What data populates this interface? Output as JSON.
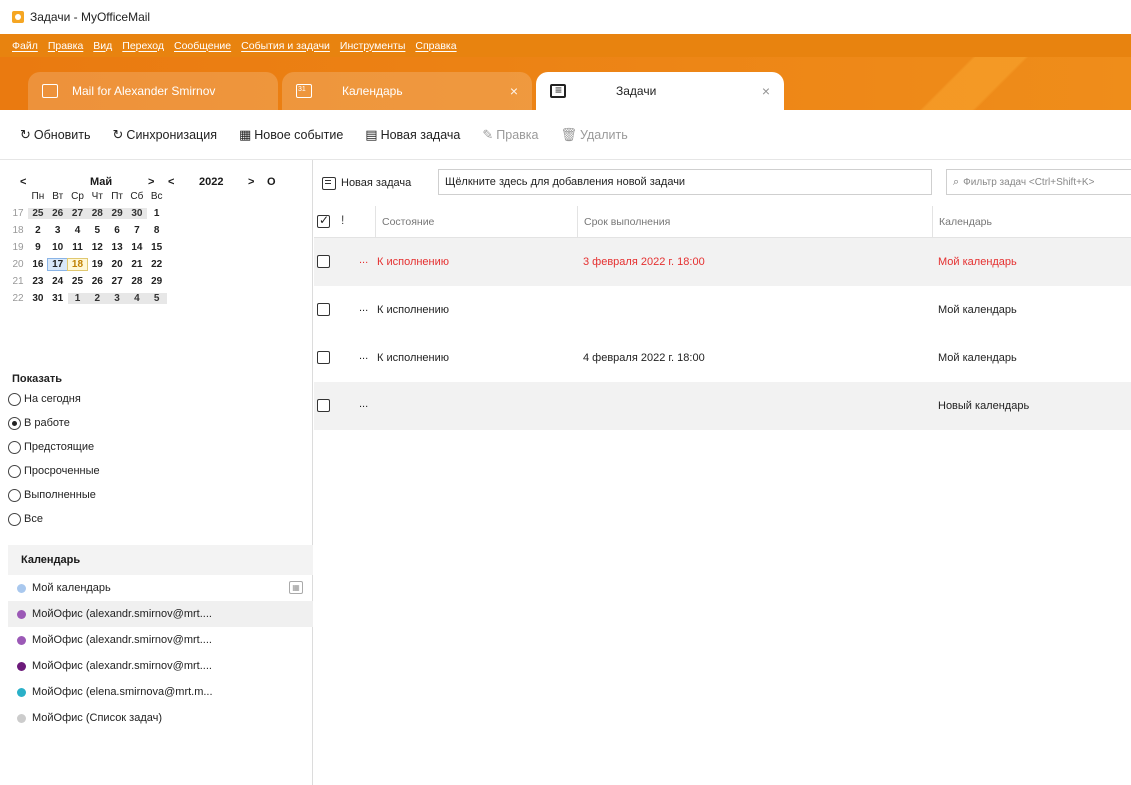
{
  "window": {
    "title": "Задачи - MyOfficeMail"
  },
  "menu": [
    "Файл",
    "Правка",
    "Вид",
    "Переход",
    "Сообщение",
    "События и задачи",
    "Инструменты",
    "Справка"
  ],
  "tabs": [
    {
      "label": "Mail for Alexander Smirnov",
      "icon": "folder-icon",
      "active": false
    },
    {
      "label": "Календарь",
      "icon": "calendar-icon",
      "active": false,
      "close": "×"
    },
    {
      "label": "Задачи",
      "icon": "tasks-icon",
      "active": true,
      "close": "×"
    }
  ],
  "toolbar": {
    "refresh": "Обновить",
    "sync": "Синхронизация",
    "new_event": "Новое событие",
    "new_task": "Новая задача",
    "edit": "Правка",
    "delete": "Удалить"
  },
  "mini_calendar": {
    "prev": "<",
    "month": "Май",
    "next": ">",
    "prev_year": "<",
    "year": "2022",
    "next_year": ">",
    "today_btn": "O",
    "weekdays": [
      "Пн",
      "Вт",
      "Ср",
      "Чт",
      "Пт",
      "Сб",
      "Вс"
    ],
    "weeks": [
      {
        "num": "17",
        "days": [
          "25",
          "26",
          "27",
          "28",
          "29",
          "30",
          "1"
        ]
      },
      {
        "num": "18",
        "days": [
          "2",
          "3",
          "4",
          "5",
          "6",
          "7",
          "8"
        ]
      },
      {
        "num": "19",
        "days": [
          "9",
          "10",
          "11",
          "12",
          "13",
          "14",
          "15"
        ]
      },
      {
        "num": "20",
        "days": [
          "16",
          "17",
          "18",
          "19",
          "20",
          "21",
          "22"
        ]
      },
      {
        "num": "21",
        "days": [
          "23",
          "24",
          "25",
          "26",
          "27",
          "28",
          "29"
        ]
      },
      {
        "num": "22",
        "days": [
          "30",
          "31",
          "1",
          "2",
          "3",
          "4",
          "5"
        ]
      }
    ]
  },
  "show": {
    "title": "Показать",
    "options": [
      {
        "label": "На сегодня",
        "checked": false
      },
      {
        "label": "В работе",
        "checked": true
      },
      {
        "label": "Предстоящие",
        "checked": false
      },
      {
        "label": "Просроченные",
        "checked": false
      },
      {
        "label": "Выполненные",
        "checked": false
      },
      {
        "label": "Все",
        "checked": false
      }
    ]
  },
  "calendars": {
    "title": "Календарь",
    "items": [
      {
        "label": "Мой календарь",
        "color": "#a9c8ee"
      },
      {
        "label": "МойОфис (alexandr.smirnov@mrt....",
        "color": "#9b59b6"
      },
      {
        "label": "МойОфис (alexandr.smirnov@mrt....",
        "color": "#9b59b6"
      },
      {
        "label": "МойОфис (alexandr.smirnov@mrt....",
        "color": "#6c1a7a"
      },
      {
        "label": "МойОфис (elena.smirnova@mrt.m...",
        "color": "#2ab0c8"
      },
      {
        "label": "МойОфис (Список задач)",
        "color": "#cccccc"
      }
    ]
  },
  "task_pane": {
    "new_task_label": "Новая задача",
    "new_task_placeholder": "Щёлкните здесь для добавления новой задачи",
    "filter_placeholder": "Фильтр задач <Ctrl+Shift+K>",
    "columns": {
      "priority": "!",
      "status": "Состояние",
      "due": "Срок выполнения",
      "calendar": "Календарь"
    },
    "rows": [
      {
        "dots": "...",
        "status": "К исполнению",
        "due": "3 февраля 2022 г. 18:00",
        "calendar": "Мой календарь",
        "overdue": true
      },
      {
        "dots": "...",
        "status": "К исполнению",
        "due": "",
        "calendar": "Мой календарь",
        "overdue": false
      },
      {
        "dots": "...",
        "status": "К исполнению",
        "due": "4 февраля 2022 г. 18:00",
        "calendar": "Мой календарь",
        "overdue": false
      },
      {
        "dots": "...",
        "status": "",
        "due": "",
        "calendar": "Новый календарь",
        "overdue": false
      }
    ]
  },
  "colors": {
    "accent": "#e8830f",
    "overdue": "#e53030"
  }
}
